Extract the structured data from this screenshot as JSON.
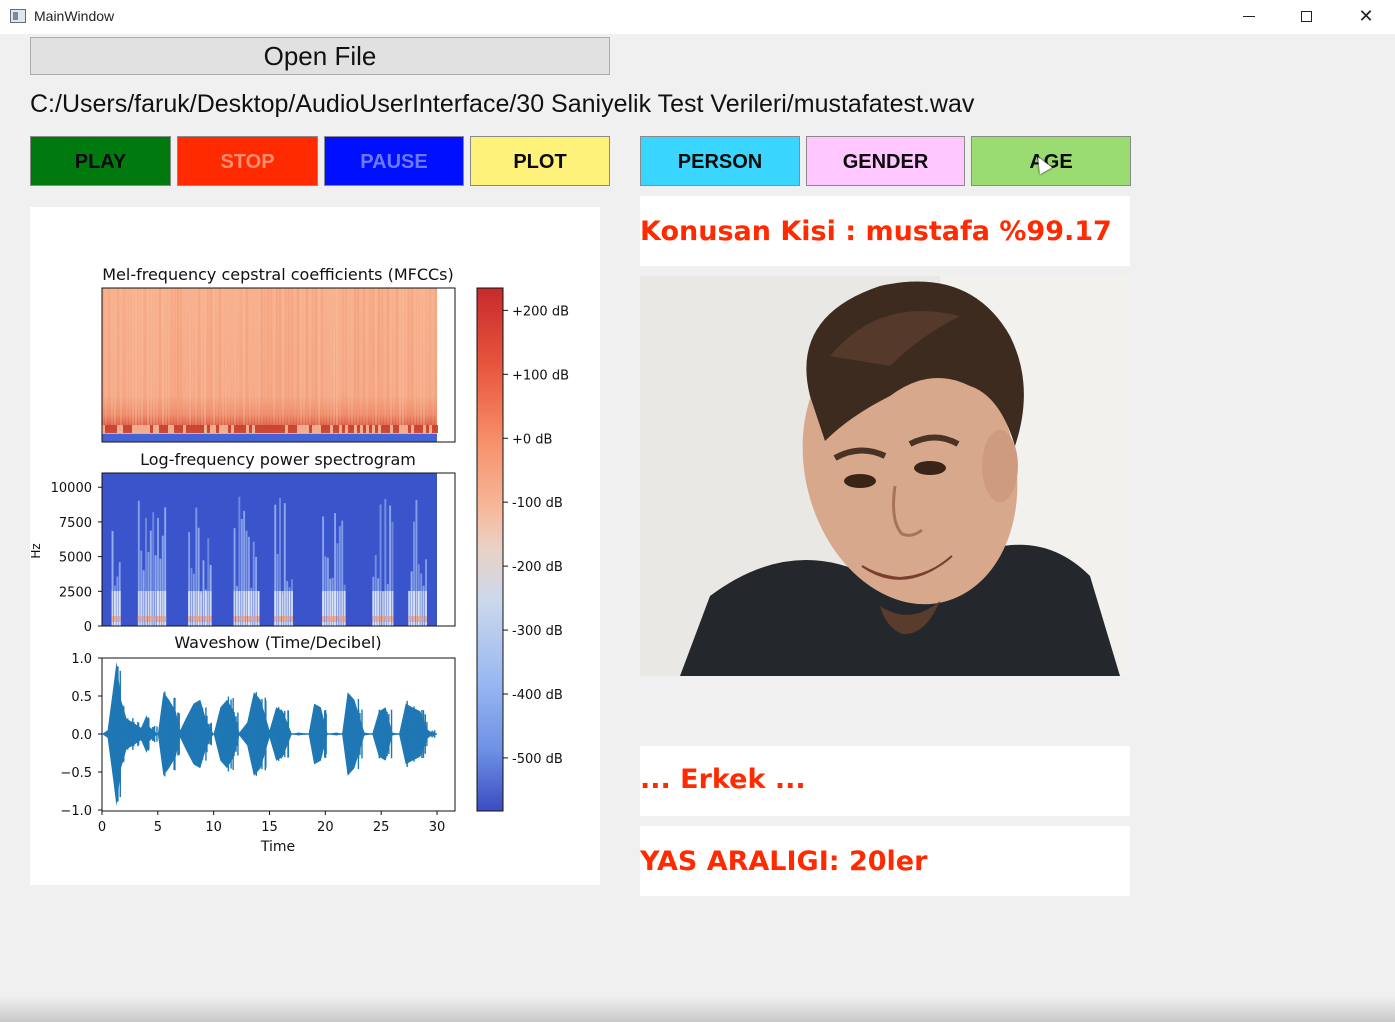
{
  "window": {
    "title": "MainWindow",
    "minimize_icon": "minimize-icon",
    "maximize_icon": "maximize-icon",
    "close_icon": "close-icon",
    "close_glyph": "✕"
  },
  "file": {
    "open_label": "Open File",
    "path": "C:/Users/faruk/Desktop/AudioUserInterface/30 Saniyelik Test Verileri/mustafatest.wav"
  },
  "controls": {
    "play": {
      "label": "PLAY",
      "bg": "#007a0e",
      "fg": "#0a0a0a"
    },
    "stop": {
      "label": "STOP",
      "bg": "#ff2a00",
      "fg": "#ff8f72"
    },
    "pause": {
      "label": "PAUSE",
      "bg": "#0010ff",
      "fg": "#6d78ff"
    },
    "plot": {
      "label": "PLOT",
      "bg": "#fff27a",
      "fg": "#0a0a0a"
    },
    "person": {
      "label": "PERSON",
      "bg": "#3ad6ff",
      "fg": "#0a0a0a"
    },
    "gender": {
      "label": "GENDER",
      "bg": "#ffc6ff",
      "fg": "#0a0a0a"
    },
    "age": {
      "label": "AGE",
      "bg": "#9adc72",
      "fg": "#0a0a0a"
    }
  },
  "results": {
    "speaker": "Konusan Kisi : mustafa %99.17",
    "gender": "... Erkek ...",
    "age": "YAS ARALIGI: 20ler",
    "color": "#ff2a00"
  },
  "photo": {
    "icon": "speaker-photo"
  },
  "plot": {
    "mfcc_title": "Mel-frequency cepstral coefficients (MFCCs)",
    "spec_title": "Log-frequency power spectrogram",
    "wave_title": "Waveshow (Time/Decibel)",
    "spec_ylabel": "Hz",
    "wave_xlabel": "Time"
  },
  "chart_data": [
    {
      "type": "heatmap",
      "title": "Mel-frequency cepstral coefficients (MFCCs)",
      "x_range": [
        0,
        30
      ],
      "colorbar": {
        "ticks": [
          "+200 dB",
          "+100 dB",
          "+0 dB",
          "-100 dB",
          "-200 dB",
          "-300 dB",
          "-400 dB",
          "-500 dB"
        ],
        "colormap": "coolwarm"
      }
    },
    {
      "type": "heatmap",
      "title": "Log-frequency power spectrogram",
      "ylabel": "Hz",
      "yticks": [
        "10000",
        "7500",
        "5000",
        "2500",
        "0"
      ],
      "ylim": [
        0,
        11025
      ],
      "x_range": [
        0,
        30
      ]
    },
    {
      "type": "line",
      "title": "Waveshow (Time/Decibel)",
      "xlabel": "Time",
      "xticks": [
        "0",
        "5",
        "10",
        "15",
        "20",
        "25",
        "30"
      ],
      "yticks": [
        "1.0",
        "0.5",
        "0.0",
        "−0.5",
        "−1.0"
      ],
      "xlim": [
        0,
        30.5
      ],
      "ylim": [
        -1.0,
        1.0
      ],
      "series": [
        {
          "x": [
            0.0,
            0.5,
            1.0,
            1.3,
            1.7,
            2.2,
            2.8,
            3.5,
            4.0,
            4.2,
            5.0,
            5.5,
            6.0,
            6.6,
            7.0,
            7.5,
            8.2,
            8.8,
            9.4,
            10.0,
            10.6,
            11.2,
            11.8,
            12.3,
            13.0,
            13.6,
            14.2,
            15.0,
            15.6,
            16.2,
            17.0,
            17.6,
            18.5,
            19.0,
            19.6,
            20.2,
            21.0,
            21.5,
            22.0,
            22.6,
            23.5,
            24.2,
            24.8,
            25.4,
            26.0,
            26.6,
            27.2,
            27.8,
            28.5,
            29.2,
            29.8,
            30.0
          ],
          "y": [
            0.0,
            0.05,
            0.6,
            0.95,
            0.45,
            0.2,
            0.15,
            0.08,
            0.25,
            0.1,
            0.0,
            0.55,
            0.45,
            0.3,
            0.05,
            0.2,
            0.4,
            0.45,
            0.15,
            0.0,
            0.35,
            0.45,
            0.3,
            0.02,
            0.15,
            0.55,
            0.45,
            0.05,
            0.35,
            0.3,
            0.0,
            0.02,
            0.0,
            0.4,
            0.35,
            0.0,
            0.02,
            0.0,
            0.55,
            0.45,
            0.02,
            0.0,
            0.3,
            0.35,
            0.02,
            0.0,
            0.4,
            0.35,
            0.3,
            0.05,
            0.0,
            0.0
          ]
        }
      ]
    }
  ]
}
